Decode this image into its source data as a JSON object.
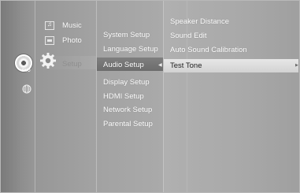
{
  "main_menu": {
    "items": [
      {
        "label": "Music",
        "icon": "music-icon"
      },
      {
        "label": "Photo",
        "icon": "photo-icon"
      },
      {
        "label": "Setup",
        "icon": "gear-icon"
      }
    ]
  },
  "side_icons": {
    "disc": {
      "icon": "disc-icon",
      "label": "DVD"
    },
    "globe": {
      "icon": "globe-icon"
    }
  },
  "setup_menu": {
    "items": [
      "System Setup",
      "Language Setup",
      "Audio Setup",
      "Display Setup",
      "HDMI Setup",
      "Network Setup",
      "Parental Setup"
    ],
    "selected": "Audio Setup"
  },
  "audio_menu": {
    "items": [
      "Speaker Distance",
      "Sound Edit",
      "Auto Sound Calibration",
      "Test Tone"
    ],
    "selected": "Test Tone"
  },
  "colors": {
    "highlight_setup": "#727272",
    "highlight_tone": "#dcdcdc",
    "text": "#ffffff",
    "selected_text": "#222222"
  }
}
